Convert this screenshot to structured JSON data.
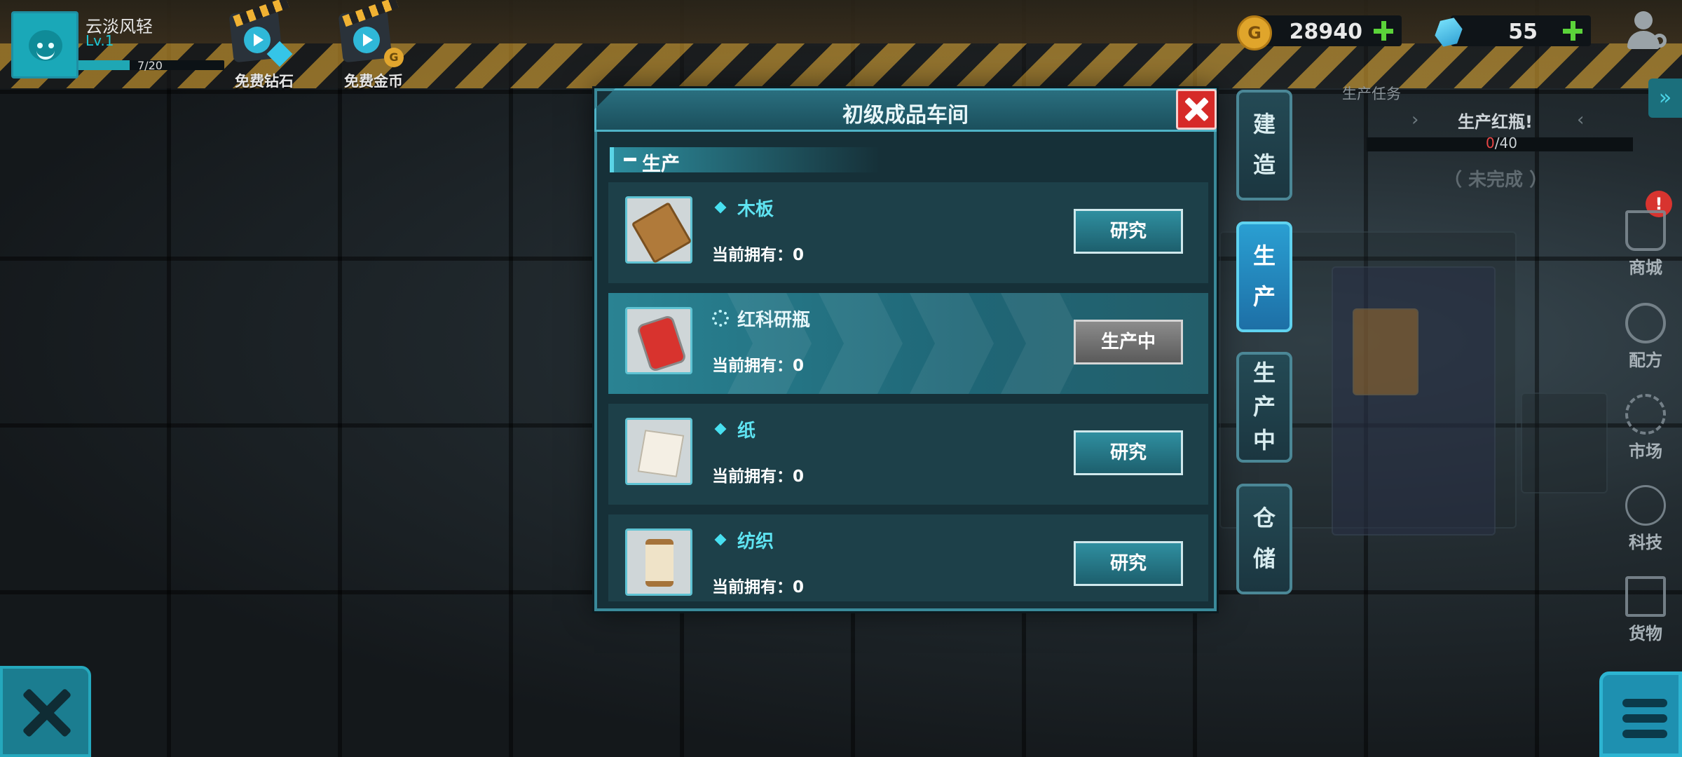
{
  "player": {
    "name": "云淡风轻",
    "level": "Lv.1",
    "xp_text": "7/20",
    "xp_fraction": 0.35
  },
  "free_buttons": [
    {
      "label": "免费钻石"
    },
    {
      "label": "免费金币"
    }
  ],
  "currency": {
    "coin_symbol": "G",
    "gold": "28940",
    "gems": "55"
  },
  "task": {
    "header": "生产任务",
    "title": "生产红瓶!",
    "progress_current": "0",
    "progress_total": "/40",
    "status": "（ 未完成 ）"
  },
  "right_menu": [
    {
      "label": "商城",
      "icon": "cart-icon"
    },
    {
      "label": "配方",
      "icon": "gear-icon"
    },
    {
      "label": "市场",
      "icon": "exchange-icon"
    },
    {
      "label": "科技",
      "icon": "network-icon"
    },
    {
      "label": "货物",
      "icon": "crate-icon"
    }
  ],
  "alert_text": "!",
  "dialog": {
    "title": "初级成品车间",
    "section": "生产",
    "items": [
      {
        "name": "木板",
        "owned": "当前拥有：0",
        "button": "研究",
        "icon": "wood-plank-icon",
        "state": "research"
      },
      {
        "name": "红科研瓶",
        "owned": "当前拥有：0",
        "button": "生产中",
        "icon": "red-flask-can-icon",
        "state": "producing"
      },
      {
        "name": "纸",
        "owned": "当前拥有：0",
        "button": "研究",
        "icon": "paper-icon",
        "state": "research"
      },
      {
        "name": "纺织",
        "owned": "当前拥有：0",
        "button": "研究",
        "icon": "thread-spool-icon",
        "state": "research"
      }
    ]
  },
  "side_tabs": [
    {
      "chars": [
        "建",
        "造"
      ],
      "active": false
    },
    {
      "chars": [
        "生",
        "产"
      ],
      "active": true
    },
    {
      "chars": [
        "生",
        "产",
        "中"
      ],
      "active": false
    },
    {
      "chars": [
        "仓",
        "储"
      ],
      "active": false
    }
  ],
  "colors": {
    "accent": "#2a9fd2",
    "title_cyan": "#5fe4f2",
    "close_red": "#d62a28",
    "plus_green": "#5bd33a"
  }
}
